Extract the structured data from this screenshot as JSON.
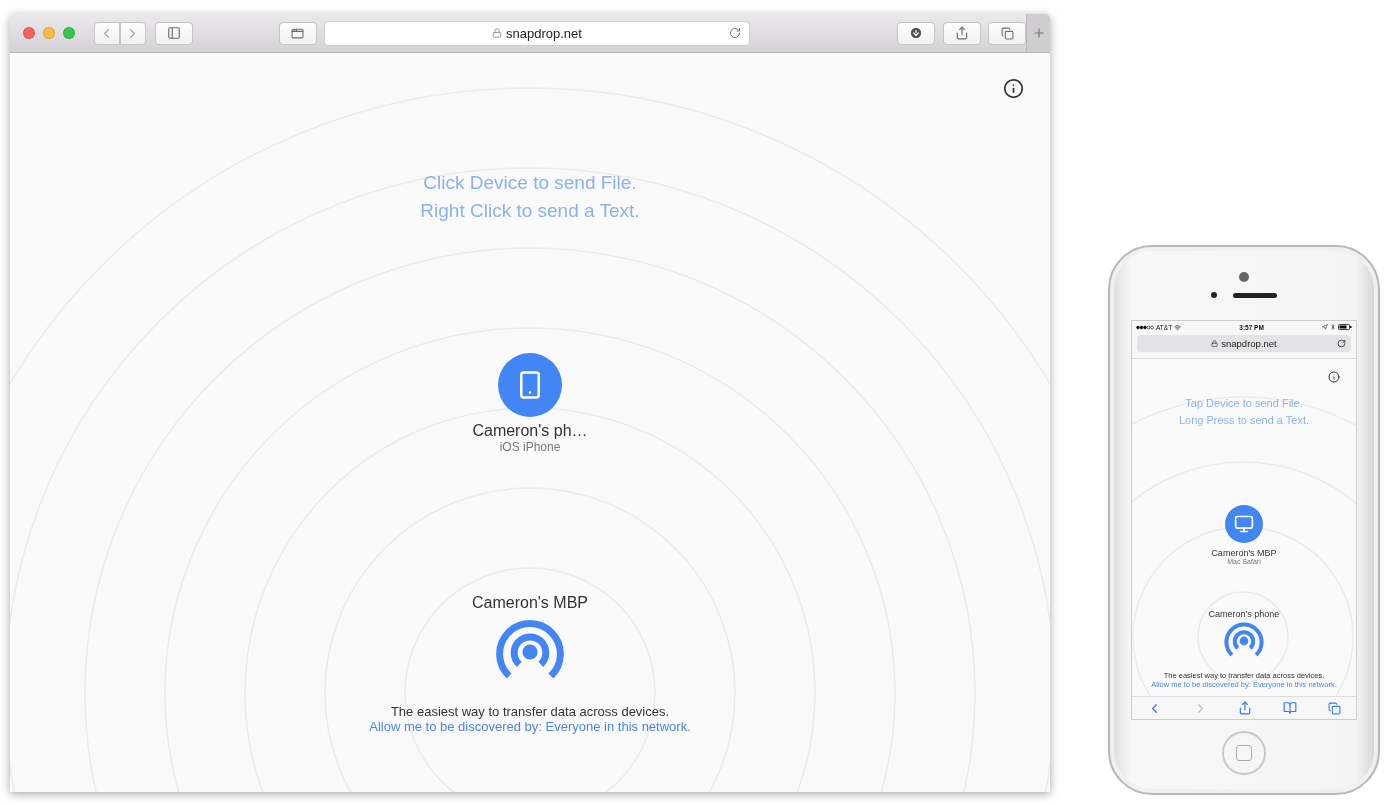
{
  "desktop": {
    "browser": {
      "url": "snapdrop.net"
    },
    "page": {
      "hint_lines": [
        "Click Device to send File.",
        "Right Click to send a Text."
      ],
      "peers": [
        {
          "name": "Cameron's ph…",
          "device": "iOS iPhone",
          "kind": "phone"
        }
      ],
      "self": {
        "name": "Cameron's MBP"
      },
      "tagline": "The easiest way to transfer data across devices.",
      "discovery_link": "Allow me to be discovered by: Everyone in this network."
    }
  },
  "phone": {
    "status_bar": {
      "carrier": "AT&T",
      "time": "3:57 PM"
    },
    "browser": {
      "url": "snapdrop.net"
    },
    "page": {
      "hint_lines": [
        "Tap Device to send File.",
        "Long Press to send a Text."
      ],
      "peers": [
        {
          "name": "Cameron's MBP",
          "device": "Mac Safari",
          "kind": "desktop"
        }
      ],
      "self": {
        "name": "Cameron's phone"
      },
      "tagline": "The easiest way to transfer data across devices.",
      "discovery_link": "Allow me to be discovered by: Everyone in this network."
    },
    "toolbar": [
      {
        "kind": "back",
        "disabled": false
      },
      {
        "kind": "forward",
        "disabled": true
      },
      {
        "kind": "share",
        "disabled": false
      },
      {
        "kind": "bookmarks",
        "disabled": false
      },
      {
        "kind": "tabs",
        "disabled": false
      }
    ]
  }
}
